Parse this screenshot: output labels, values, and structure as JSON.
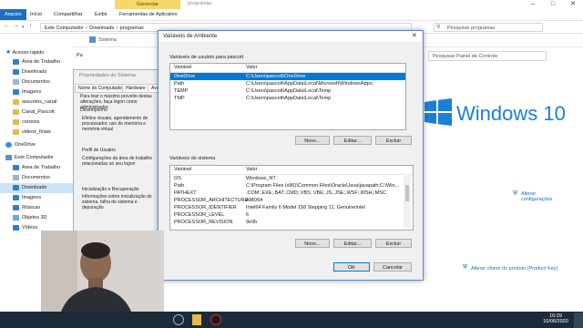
{
  "explorer": {
    "context_tab": "Gerenciar",
    "window_title": "programas",
    "ribbon_tabs": [
      "Arquivo",
      "Início",
      "Compartilhar",
      "Exibir",
      "Ferramentas de Aplicativo"
    ],
    "address": {
      "crumbs": [
        "Este Computador",
        "Downloads",
        "programas"
      ],
      "separator": ">"
    },
    "search_placeholder": "Pesquisar programas",
    "nav": [
      {
        "label": "Acesso rápido",
        "icon": "star-icon",
        "level": 0
      },
      {
        "label": "Área de Trabalho",
        "icon": "desktop-icon",
        "level": 1
      },
      {
        "label": "Downloads",
        "icon": "download-icon",
        "level": 1
      },
      {
        "label": "Documentos",
        "icon": "documents-icon",
        "level": 1
      },
      {
        "label": "Imagens",
        "icon": "pictures-icon",
        "level": 1
      },
      {
        "label": "assuntos_canal",
        "icon": "folder-icon",
        "level": 1
      },
      {
        "label": "Canal_Pascott",
        "icon": "folder-icon",
        "level": 1
      },
      {
        "label": "correios",
        "icon": "folder-icon",
        "level": 1
      },
      {
        "label": "videos_finais",
        "icon": "folder-icon",
        "level": 1
      },
      {
        "label": "OneDrive",
        "icon": "onedrive-icon",
        "level": 0
      },
      {
        "label": "Este Computador",
        "icon": "computer-icon",
        "level": 0
      },
      {
        "label": "Área de Trabalho",
        "icon": "desktop-icon",
        "level": 1
      },
      {
        "label": "Documentos",
        "icon": "documents-icon",
        "level": 1
      },
      {
        "label": "Downloads",
        "icon": "download-icon",
        "level": 1,
        "selected": true
      },
      {
        "label": "Imagens",
        "icon": "pictures-icon",
        "level": 1
      },
      {
        "label": "Músicas",
        "icon": "music-icon",
        "level": 1
      },
      {
        "label": "Objetos 3D",
        "icon": "objects-3d-icon",
        "level": 1
      },
      {
        "label": "Vídeos",
        "icon": "videos-icon",
        "level": 1
      }
    ]
  },
  "system_window": {
    "title": "Sistema",
    "search_placeholder": "Pesquisar Painel de Controle",
    "brand": "Windows 10",
    "change_settings": "Alterar configurações",
    "change_key": "Alterar chave do produto (Product Key)",
    "nav_partial": "Pa"
  },
  "system_props": {
    "title": "Propriedades do Sistema",
    "tabs": [
      "Nome do Computador",
      "Hardware",
      "Avan"
    ],
    "intro": "Para tirar o máximo proveito destas alterações, faça logon como administrador.",
    "perf_title": "Desempenho",
    "perf_text": "Efeitos visuais, agendamento de processador, uso de memória e memória virtual",
    "profile_title": "Perfil de Usuário",
    "profile_text": "Configurações da área de trabalho relacionadas ao seu logon",
    "startup_title": "Inicialização e Recuperação",
    "startup_text": "Informações sobre inicialização do sistema, falha do sistema e depuração"
  },
  "env_dialog": {
    "title": "Variáveis de Ambiente",
    "user_group": "Variáveis de usuário para pascott",
    "col_var": "Variável",
    "col_val": "Valor",
    "user_vars": [
      {
        "name": "OneDrive",
        "value": "C:\\Users\\pascott\\OneDrive",
        "selected": true
      },
      {
        "name": "Path",
        "value": "C:\\Users\\pascott\\AppData\\Local\\Microsoft\\WindowsApps;"
      },
      {
        "name": "TEMP",
        "value": "C:\\Users\\pascott\\AppData\\Local\\Temp"
      },
      {
        "name": "TMP",
        "value": "C:\\Users\\pascott\\AppData\\Local\\Temp"
      }
    ],
    "system_group": "Variáveis do sistema",
    "system_vars": [
      {
        "name": "OS",
        "value": "Windows_NT"
      },
      {
        "name": "Path",
        "value": "C:\\Program Files (x86)\\Common Files\\Oracle\\Java\\javapath;C:\\Win..."
      },
      {
        "name": "PATHEXT",
        "value": ".COM;.EXE;.BAT;.CMD;.VBS;.VBE;.JS;.JSE;.WSF;.WSH;.MSC"
      },
      {
        "name": "PROCESSOR_ARCHITECTURE",
        "value": "AMD64"
      },
      {
        "name": "PROCESSOR_IDENTIFIER",
        "value": "Intel64 Family 6 Model 158 Stepping 11, GenuineIntel"
      },
      {
        "name": "PROCESSOR_LEVEL",
        "value": "6"
      },
      {
        "name": "PROCESSOR_REVISION",
        "value": "9e0b"
      }
    ],
    "btn_new": "Novo...",
    "btn_edit": "Editar...",
    "btn_delete": "Excluir",
    "btn_ok": "OK",
    "btn_cancel": "Cancelar"
  },
  "taskbar": {
    "time": "16:29",
    "date": "10/06/2020"
  },
  "colors": {
    "accent": "#0078d7",
    "windows_blue": "#1b7fd6",
    "taskbar": "#1c2b3a"
  }
}
